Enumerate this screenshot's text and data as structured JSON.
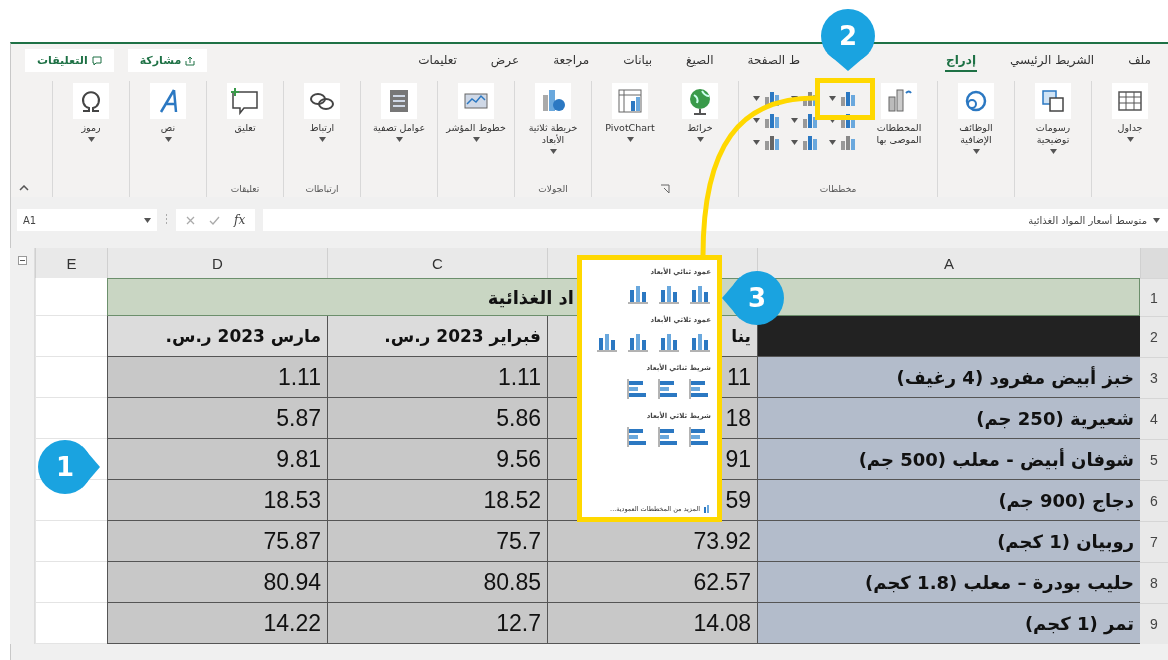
{
  "ribbon": {
    "tabs": [
      {
        "label": "ملف",
        "selected": false
      },
      {
        "label": "الشريط الرئيسي",
        "selected": false
      },
      {
        "label": "إدراج",
        "selected": true
      },
      {
        "label": "ط الصفحة",
        "selected": false
      },
      {
        "label": "الصيغ",
        "selected": false
      },
      {
        "label": "بيانات",
        "selected": false
      },
      {
        "label": "مراجعة",
        "selected": false
      },
      {
        "label": "عرض",
        "selected": false
      },
      {
        "label": "تعليمات",
        "selected": false
      }
    ],
    "share_button": "مشاركة",
    "comments_button": "التعليقات",
    "groups": [
      {
        "commands": [
          {
            "label": "جداول",
            "menu": true
          }
        ]
      },
      {
        "commands": [
          {
            "label": "رسومات توضيحية",
            "menu": true
          }
        ]
      },
      {
        "commands": [
          {
            "label": "الوظائف الإضافية",
            "menu": true
          }
        ]
      },
      {
        "label": "مخططات",
        "commands": [
          {
            "label": "المخططات الموصى بها",
            "menu": false
          }
        ]
      },
      {
        "commands": [
          {
            "label": "خرائط",
            "menu": true
          },
          {
            "label": "PivotChart",
            "menu": true
          }
        ]
      },
      {
        "label": "الجولات",
        "commands": [
          {
            "label": "خريطة ثلاثية الأبعاد",
            "menu": true
          }
        ]
      },
      {
        "commands": [
          {
            "label": "خطوط المؤشر",
            "menu": true
          }
        ]
      },
      {
        "commands": [
          {
            "label": "عوامل تصفية",
            "menu": true
          }
        ]
      },
      {
        "label": "ارتباطات",
        "commands": [
          {
            "label": "ارتباط",
            "menu": true
          }
        ]
      },
      {
        "label": "تعليقات",
        "commands": [
          {
            "label": "تعليق",
            "menu": false
          }
        ]
      },
      {
        "commands": [
          {
            "label": "نص",
            "menu": true
          }
        ]
      },
      {
        "commands": [
          {
            "label": "رموز",
            "menu": true
          }
        ]
      }
    ]
  },
  "formula_bar": {
    "name_box": "A1",
    "function_label": "fx",
    "formula": "متوسط أسعار المواد الغذائية"
  },
  "sheet": {
    "columns": [
      {
        "label": "A"
      },
      {},
      {
        "label": "C"
      },
      {
        "label": "D"
      },
      {
        "label": "E"
      }
    ],
    "rows": [
      {
        "number": "1",
        "title": "اد الغذائية"
      },
      {
        "number": "2",
        "cells": [
          "",
          "ينا",
          "فبراير 2023 ر.س.",
          "مارس 2023 ر.س."
        ]
      },
      {
        "number": "3",
        "cells": [
          "خبز أبيض مفرود (4 رغيف)",
          "11",
          "1.11",
          "1.11"
        ]
      },
      {
        "number": "4",
        "cells": [
          "شعيرية (250 جم)",
          "18",
          "5.86",
          "5.87"
        ]
      },
      {
        "number": "5",
        "cells": [
          "شوفان أبيض - معلب (500 جم)",
          "91",
          "9.56",
          "9.81"
        ]
      },
      {
        "number": "6",
        "cells": [
          "دجاج (900 جم)",
          "59",
          "18.52",
          "18.53"
        ]
      },
      {
        "number": "7",
        "cells": [
          "روبيان (1 كجم)",
          "73.92",
          "75.7",
          "75.87"
        ]
      },
      {
        "number": "8",
        "cells": [
          "حليب بودرة – معلب (1.8 كجم)",
          "62.57",
          "80.85",
          "80.94"
        ]
      },
      {
        "number": "9",
        "cells": [
          "تمر (1 كجم)",
          "14.08",
          "12.7",
          "14.22"
        ]
      }
    ]
  },
  "chart_menu": {
    "sections": [
      {
        "title": "عمود ثنائي الأبعاد"
      },
      {
        "title": "عمود ثلاثي الأبعاد"
      },
      {
        "title": "شريط ثنائي الأبعاد"
      },
      {
        "title": "شريط ثلاثي الأبعاد"
      }
    ],
    "footer": "المزيد من المخططات العمودية..."
  },
  "callouts": [
    {
      "number": "1"
    },
    {
      "number": "2"
    },
    {
      "number": "3"
    }
  ]
}
